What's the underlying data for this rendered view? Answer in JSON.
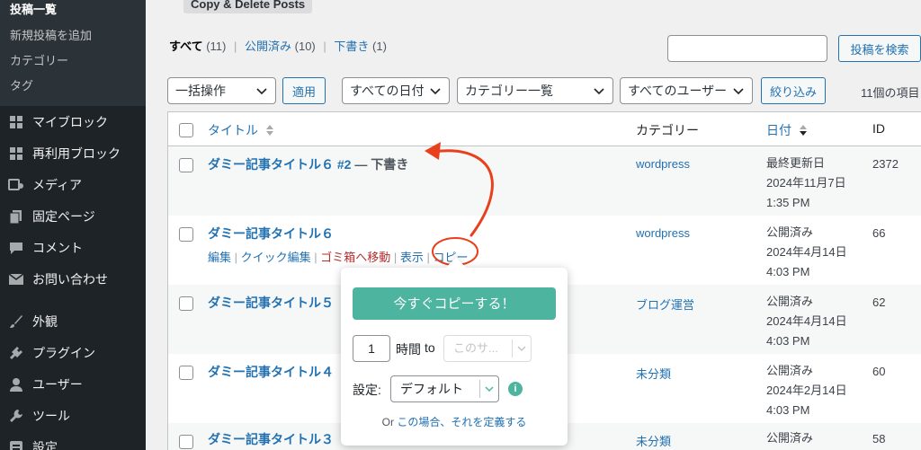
{
  "sidebar": {
    "submenu": [
      "投稿一覧",
      "新規投稿を追加",
      "カテゴリー",
      "タグ"
    ],
    "menu": [
      {
        "label": "マイブロック",
        "icon": "grid-icon"
      },
      {
        "label": "再利用ブロック",
        "icon": "grid-icon"
      },
      {
        "label": "メディア",
        "icon": "media-icon"
      },
      {
        "label": "固定ページ",
        "icon": "page-icon"
      },
      {
        "label": "コメント",
        "icon": "comment-icon"
      },
      {
        "label": "お問い合わせ",
        "icon": "mail-icon"
      },
      {
        "label": "外観",
        "icon": "brush-icon"
      },
      {
        "label": "プラグイン",
        "icon": "plugin-icon"
      },
      {
        "label": "ユーザー",
        "icon": "user-icon"
      },
      {
        "label": "ツール",
        "icon": "wrench-icon"
      },
      {
        "label": "設定",
        "icon": "settings-icon"
      }
    ]
  },
  "plugin_tab": "Copy & Delete Posts",
  "views": {
    "all": "すべて",
    "all_count": "(11)",
    "published": "公開済み",
    "published_count": "(10)",
    "draft": "下書き",
    "draft_count": "(1)"
  },
  "search": {
    "placeholder": "",
    "button": "投稿を検索"
  },
  "filters": {
    "bulk": "一括操作",
    "apply": "適用",
    "dates": "すべての日付",
    "categories": "カテゴリー一覧",
    "users": "すべてのユーザー",
    "filter_button": "絞り込み",
    "item_count": "11個の項目"
  },
  "table": {
    "headers": {
      "title": "タイトル",
      "category": "カテゴリー",
      "date": "日付",
      "id": "ID"
    },
    "rows": [
      {
        "title": "ダミー記事タイトル６ #2",
        "state": " — 下書き",
        "category": "wordpress",
        "date_status": "最終更新日",
        "date": "2024年11月7日",
        "time": "1:35 PM",
        "id": "2372"
      },
      {
        "title": "ダミー記事タイトル６",
        "state": "",
        "category": "wordpress",
        "date_status": "公開済み",
        "date": "2024年4月14日",
        "time": "4:03 PM",
        "id": "66"
      },
      {
        "title": "ダミー記事タイトル５",
        "state": "",
        "category": "ブログ運営",
        "date_status": "公開済み",
        "date": "2024年4月14日",
        "time": "4:03 PM",
        "id": "62"
      },
      {
        "title": "ダミー記事タイトル４",
        "state": "",
        "category": "未分類",
        "date_status": "公開済み",
        "date": "2024年2月14日",
        "time": "4:03 PM",
        "id": "60"
      },
      {
        "title": "ダミー記事タイトル３",
        "state": "",
        "category": "未分類",
        "date_status": "公開済み",
        "date": "",
        "time": "",
        "id": "58"
      }
    ],
    "row_actions": {
      "edit": "編集",
      "quick_edit": "クイック編集",
      "trash": "ゴミ箱へ移動",
      "view": "表示",
      "copy": "コピー"
    }
  },
  "popup": {
    "copy_now": "今すぐコピーする！",
    "hours_value": "1",
    "hours_label": "時間",
    "to_label": "to",
    "site_placeholder": "このサ...",
    "settings_label": "設定:",
    "settings_value": "デフォルト",
    "or_text": "Or",
    "define_link": "この場合、それを定義する"
  },
  "colors": {
    "accent": "#2271b1",
    "annotation": "#e8401c",
    "popup_button": "#4db59f",
    "sidebar": "#1d2327"
  }
}
